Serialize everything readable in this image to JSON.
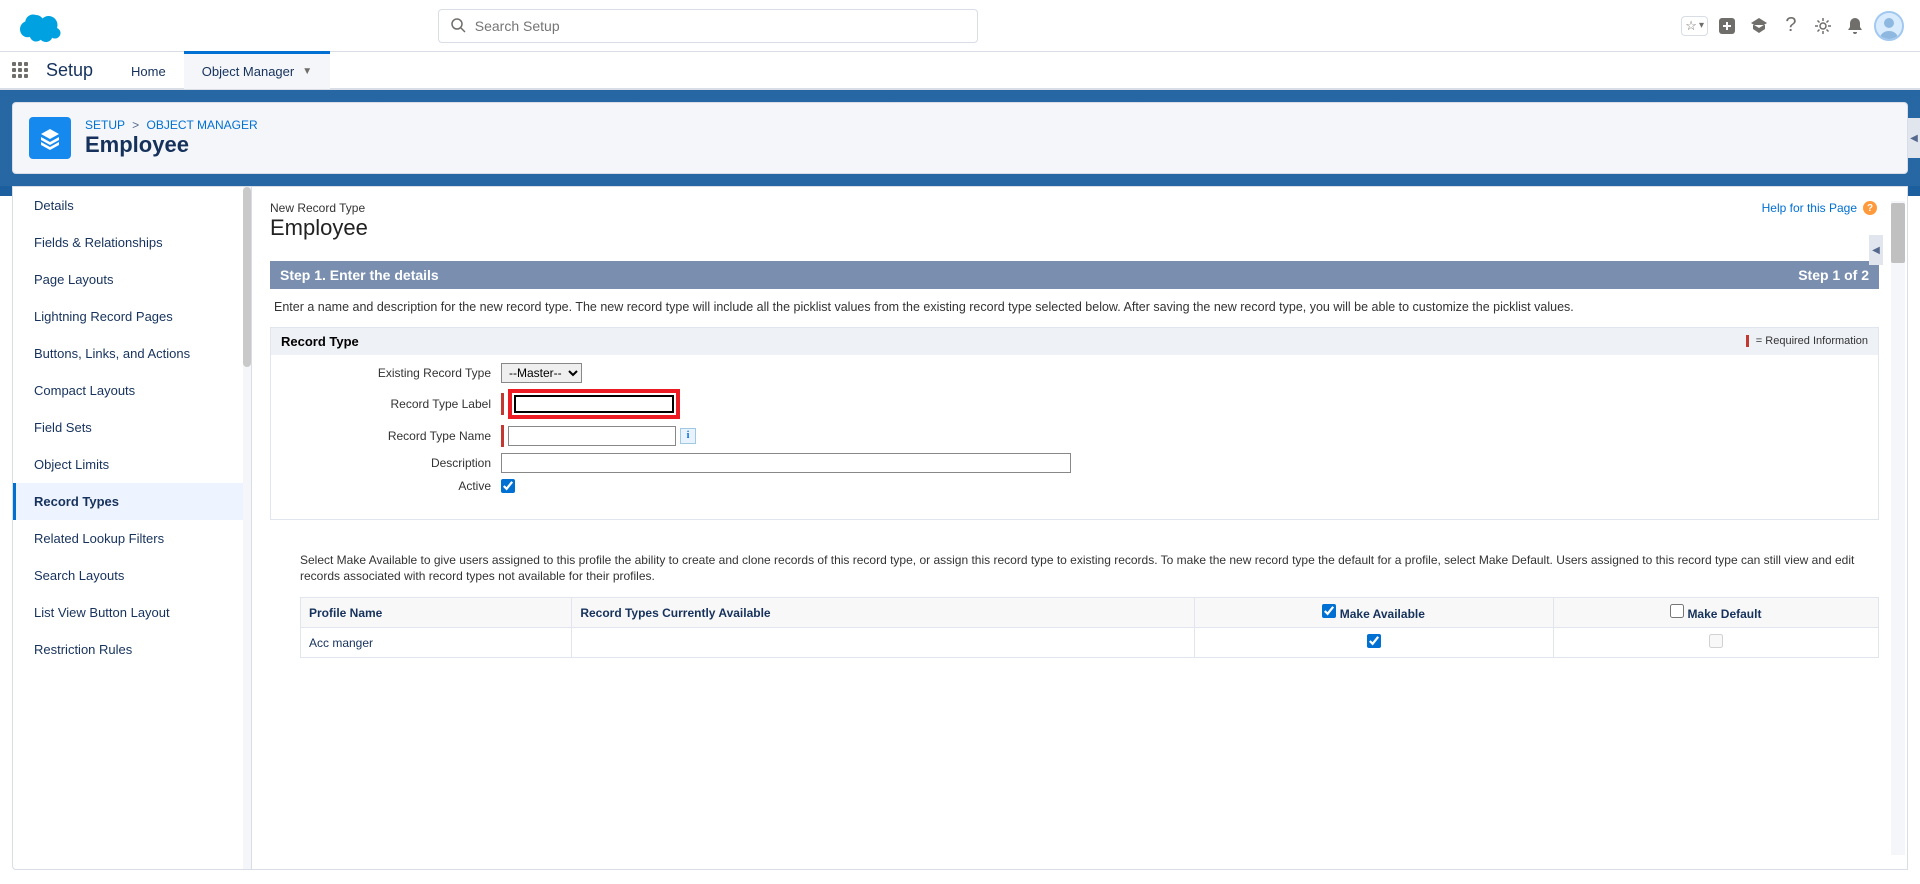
{
  "header": {
    "search_placeholder": "Search Setup",
    "setup_label": "Setup",
    "tabs": {
      "home": "Home",
      "object_manager": "Object Manager"
    }
  },
  "breadcrumb": {
    "setup": "SETUP",
    "object_manager": "OBJECT MANAGER"
  },
  "page_title": "Employee",
  "sidebar": {
    "items": [
      {
        "label": "Details"
      },
      {
        "label": "Fields & Relationships"
      },
      {
        "label": "Page Layouts"
      },
      {
        "label": "Lightning Record Pages"
      },
      {
        "label": "Buttons, Links, and Actions"
      },
      {
        "label": "Compact Layouts"
      },
      {
        "label": "Field Sets"
      },
      {
        "label": "Object Limits"
      },
      {
        "label": "Record Types"
      },
      {
        "label": "Related Lookup Filters"
      },
      {
        "label": "Search Layouts"
      },
      {
        "label": "List View Button Layout"
      },
      {
        "label": "Restriction Rules"
      }
    ]
  },
  "main": {
    "subtitle": "New Record Type",
    "title": "Employee",
    "help_label": "Help for this Page",
    "step_title": "Step 1. Enter the details",
    "step_indicator": "Step 1 of 2",
    "step_desc": "Enter a name and description for the new record type. The new record type will include all the picklist values from the existing record type selected below. After saving the new record type, you will be able to customize the picklist values.",
    "rt_section_title": "Record Type",
    "required_info": "= Required Information",
    "form": {
      "existing_label": "Existing Record Type",
      "existing_value": "--Master--",
      "label_label": "Record Type Label",
      "label_value": "",
      "name_label": "Record Type Name",
      "name_value": "",
      "desc_label": "Description",
      "desc_value": "",
      "active_label": "Active"
    },
    "profile_desc": "Select Make Available to give users assigned to this profile the ability to create and clone records of this record type, or assign this record type to existing records. To make the new record type the default for a profile, select Make Default. Users assigned to this record type can still view and edit records associated with record types not available for their profiles.",
    "profile_table": {
      "headers": {
        "name": "Profile Name",
        "available": "Record Types Currently Available",
        "make_available": "Make Available",
        "make_default": "Make Default"
      },
      "rows": [
        {
          "name": "Acc manger",
          "available": "",
          "make_available": true,
          "make_default": false
        }
      ]
    }
  }
}
